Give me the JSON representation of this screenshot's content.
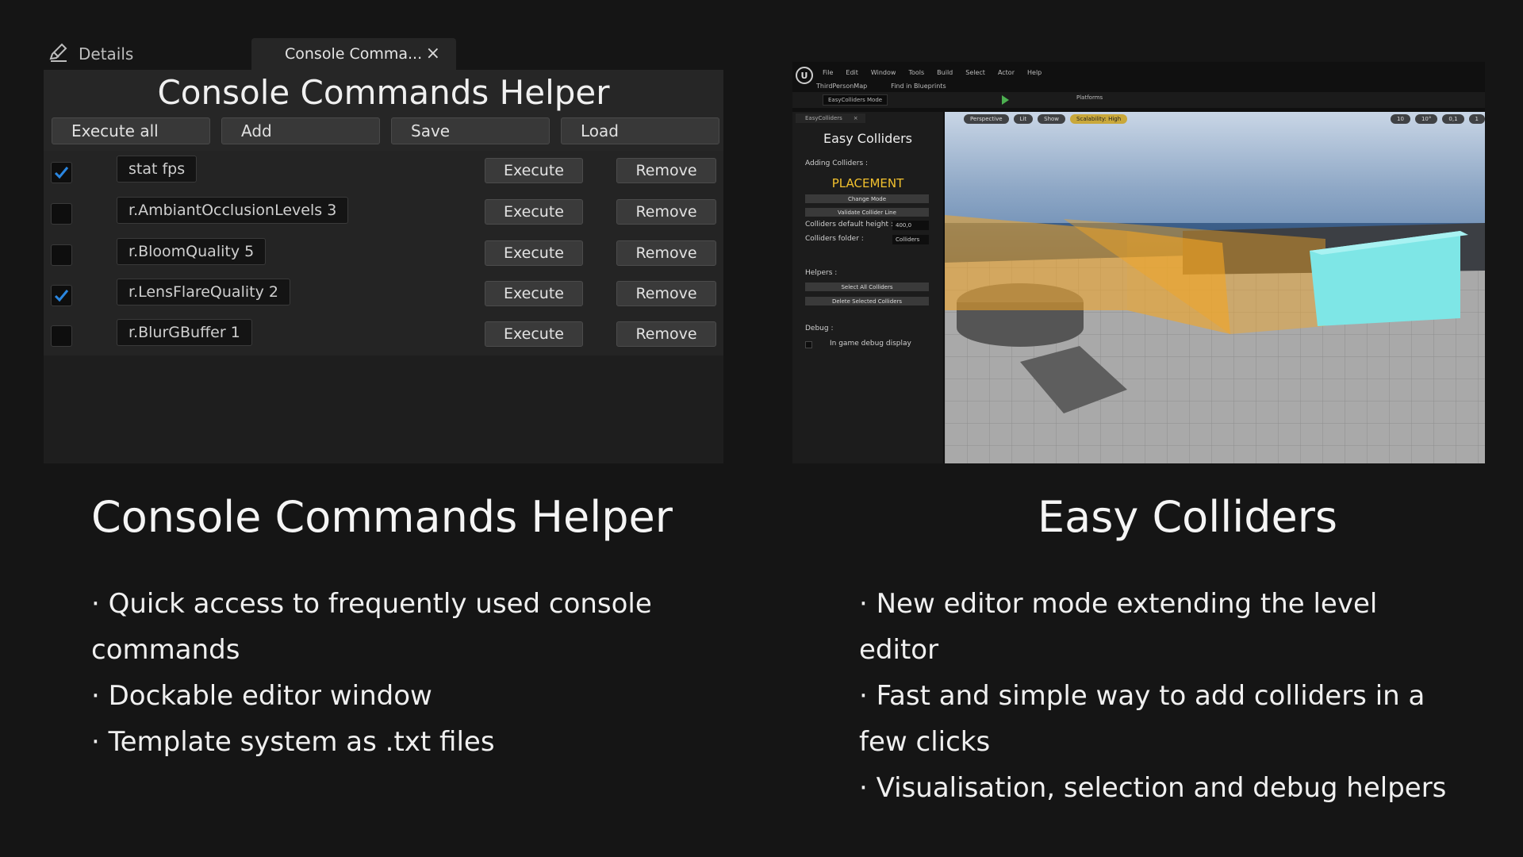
{
  "cch": {
    "tabs": {
      "details": "Details",
      "active": "Console Comma..."
    },
    "title": "Console Commands Helper",
    "toolbar": {
      "execute_all": "Execute all",
      "add": "Add",
      "save": "Save",
      "load": "Load"
    },
    "rows": [
      {
        "checked": true,
        "command": "stat fps"
      },
      {
        "checked": false,
        "command": "r.AmbiantOcclusionLevels 3"
      },
      {
        "checked": false,
        "command": "r.BloomQuality 5"
      },
      {
        "checked": true,
        "command": "r.LensFlareQuality 2"
      },
      {
        "checked": false,
        "command": "r.BlurGBuffer 1"
      }
    ],
    "execute_label": "Execute",
    "remove_label": "Remove"
  },
  "ue": {
    "menu": [
      "File",
      "Edit",
      "Window",
      "Tools",
      "Build",
      "Select",
      "Actor",
      "Help"
    ],
    "map_tab": "ThirdPersonMap",
    "find_bp": "Find in Blueprints",
    "mode_select": "EasyColliders Mode",
    "platforms": "Platforms",
    "panel_tab": "EasyColliders",
    "panel_title": "Easy Colliders",
    "adding_colliders": "Adding Colliders :",
    "placement": "PLACEMENT",
    "change_mode": "Change Mode",
    "validate_line": "Validate Collider Line",
    "default_height_label": "Colliders default height :",
    "default_height_value": "400,0",
    "folder_label": "Colliders folder :",
    "folder_value": "Colliders",
    "helpers": "Helpers :",
    "select_all": "Select All Colliders",
    "delete_selected": "Delete Selected Colliders",
    "debug": "Debug :",
    "ingame_debug": "In game debug display",
    "vp_perspective": "Perspective",
    "vp_lit": "Lit",
    "vp_show": "Show",
    "vp_scalability": "Scalability: High",
    "vp_grid": "10",
    "vp_angle": "10°",
    "vp_scale": "0,1",
    "vp_speed": "1"
  },
  "captions": {
    "left_title": "Console Commands Helper",
    "left_bullets": [
      "· Quick access to frequently used console commands",
      "· Dockable editor window",
      "· Template system as .txt files"
    ],
    "right_title": "Easy Colliders",
    "right_bullets": [
      "· New editor mode extending the level editor",
      "· Fast and simple way to add colliders in a few clicks",
      "· Visualisation, selection and debug helpers"
    ]
  },
  "colors": {
    "background": "#151515",
    "accent_blue": "#2a86e0",
    "placement_yellow": "#f2c12e",
    "collider_orange": "#f5a623",
    "collider_cyan": "#7ee6e6"
  }
}
